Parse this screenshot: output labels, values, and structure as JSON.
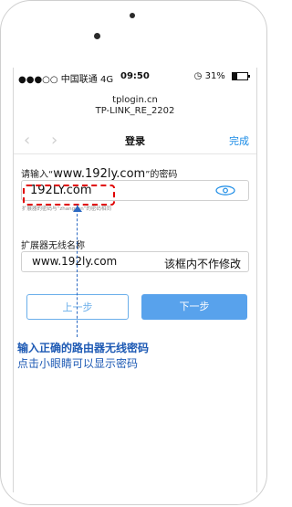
{
  "status_bar": {
    "carrier": "●●●○○ 中国联通 4G",
    "time": "09:50",
    "battery": "31%",
    "battery_level": 0.31
  },
  "address": {
    "line1": "tplogin.cn",
    "line2": "TP-LINK_RE_2202"
  },
  "nav": {
    "back_icon": "chevron-left",
    "forward_icon": "chevron-right",
    "title": "登录",
    "done": "完成"
  },
  "form": {
    "password_label_prefix": "请输入“",
    "password_label_site": "www.192ly.com",
    "password_label_suffix": "”的密码",
    "password_value": "192LY.com",
    "eye_icon": "eye",
    "password_hint": "扩展器的密码与“zhangsan”的密码相同",
    "ssid_label": "扩展器无线名称",
    "ssid_value": "www.192ly.com",
    "ssid_note": "该框内不作修改",
    "prev_button": "上一步",
    "next_button": "下一步"
  },
  "annotation": {
    "title": "输入正确的路由器无线密码",
    "subtitle": "点击小眼睛可以显示密码"
  },
  "colors": {
    "accent": "#1a8be6",
    "annotation": "#1e5ab4",
    "highlight": "#e00000"
  }
}
